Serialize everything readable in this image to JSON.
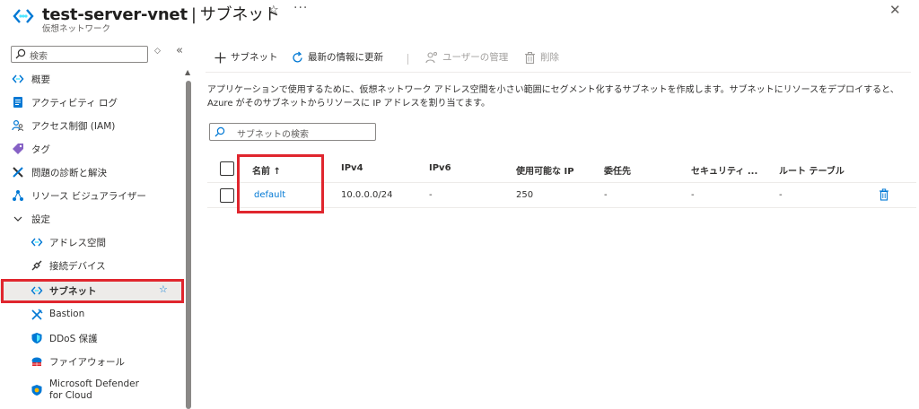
{
  "header": {
    "title": "test-server-vnet",
    "separator": "|",
    "section": "サブネット",
    "subtitle": "仮想ネットワーク",
    "star_glyph": "☆",
    "more_glyph": "···",
    "close_glyph": "✕"
  },
  "sidebar": {
    "search_placeholder": "検索",
    "sort_glyph": "◇",
    "collapse_glyph": "«",
    "items": [
      {
        "label": "概要",
        "icon": "vnet-icon"
      },
      {
        "label": "アクティビティ ログ",
        "icon": "log-icon"
      },
      {
        "label": "アクセス制御 (IAM)",
        "icon": "iam-icon"
      },
      {
        "label": "タグ",
        "icon": "tag-icon"
      },
      {
        "label": "問題の診断と解決",
        "icon": "wrench-icon"
      },
      {
        "label": "リソース ビジュアライザー",
        "icon": "visualizer-icon"
      },
      {
        "label": "設定",
        "icon": "chevron-down-icon"
      },
      {
        "label": "アドレス空間",
        "icon": "address-space-icon"
      },
      {
        "label": "接続デバイス",
        "icon": "connected-devices-icon"
      },
      {
        "label": "サブネット",
        "icon": "subnet-icon"
      },
      {
        "label": "Bastion",
        "icon": "bastion-icon"
      },
      {
        "label": "DDoS 保護",
        "icon": "ddos-shield-icon"
      },
      {
        "label": "ファイアウォール",
        "icon": "firewall-icon"
      },
      {
        "label": "Microsoft Defender for Cloud",
        "icon": "defender-icon"
      }
    ],
    "selected_star_glyph": "☆"
  },
  "toolbar": {
    "add_subnet": "サブネット",
    "refresh": "最新の情報に更新",
    "manage_users": "ユーザーの管理",
    "delete": "削除"
  },
  "description": "アプリケーションで使用するために、仮想ネットワーク アドレス空間を小さい範囲にセグメント化するサブネットを作成します。サブネットにリソースをデプロイすると、Azure がそのサブネットからリソースに IP アドレスを割り当てます。",
  "filter": {
    "placeholder": "サブネットの検索"
  },
  "table": {
    "columns": [
      "名前 ↑",
      "IPv4",
      "IPv6",
      "使用可能な IP",
      "委任先",
      "セキュリティ ...",
      "ルート テーブル"
    ],
    "rows": [
      {
        "name": "default",
        "ipv4": "10.0.0.0/24",
        "ipv6": "-",
        "available_ip": "250",
        "delegated": "-",
        "security": "-",
        "route_table": "-"
      }
    ]
  },
  "colors": {
    "accent": "#0078d4",
    "highlight": "#e0262e"
  }
}
